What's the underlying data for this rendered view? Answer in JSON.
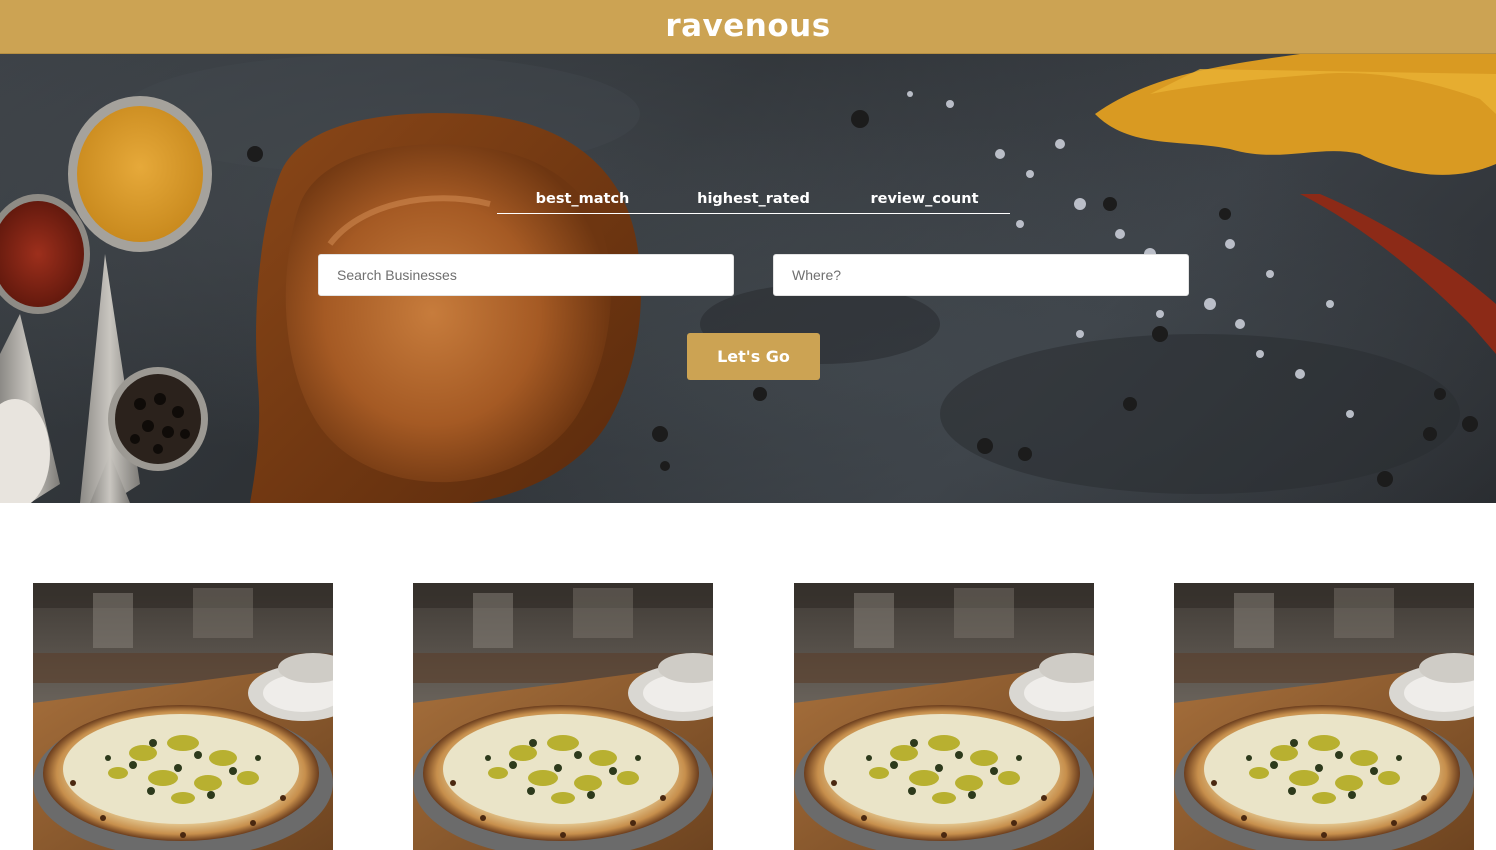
{
  "app": {
    "title": "ravenous",
    "brand_color": "#cca353"
  },
  "search": {
    "sort_options": [
      {
        "label": "best_match"
      },
      {
        "label": "highest_rated"
      },
      {
        "label": "review_count"
      }
    ],
    "business_placeholder": "Search Businesses",
    "location_placeholder": "Where?",
    "submit_label": "Let's Go"
  },
  "business_list": {
    "cards": [
      {
        "image": "pizza-image"
      },
      {
        "image": "pizza-image"
      },
      {
        "image": "pizza-image"
      },
      {
        "image": "pizza-image"
      }
    ]
  }
}
